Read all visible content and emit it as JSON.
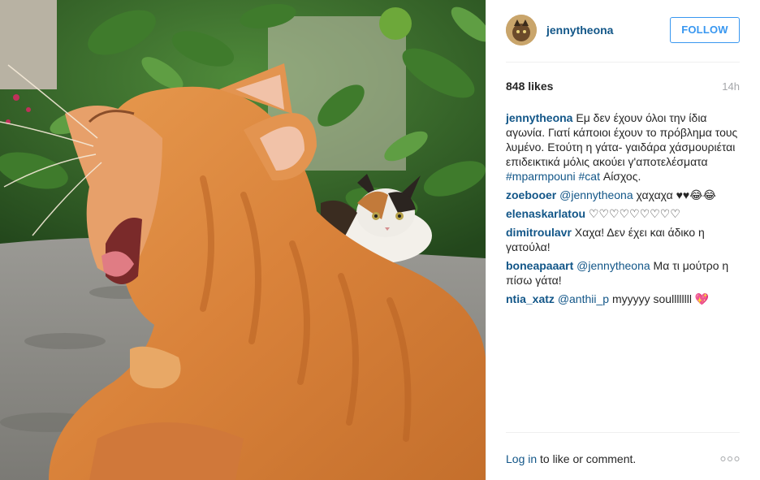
{
  "post": {
    "username": "jennytheona",
    "follow_label": "FOLLOW",
    "likes": "848 likes",
    "time": "14h"
  },
  "comments": [
    {
      "author": "jennytheona",
      "parts": [
        {
          "t": "text",
          "v": " Εμ δεν έχουν όλοι την ίδια αγωνία. Γιατί κάποιοι έχουν το πρόβλημα τους λυμένο. Ετούτη η γάτα- γαιδάρα χάσμουριέται επιδεικτικά μόλις ακούει γ'αποτελέσματα "
        },
        {
          "t": "tag",
          "v": "#mparmpouni"
        },
        {
          "t": "text",
          "v": " "
        },
        {
          "t": "tag",
          "v": "#cat"
        },
        {
          "t": "text",
          "v": " Αίσχος."
        }
      ]
    },
    {
      "author": "zoebooer",
      "parts": [
        {
          "t": "text",
          "v": " "
        },
        {
          "t": "mention",
          "v": "@jennytheona"
        },
        {
          "t": "text",
          "v": " χαχαχα ♥♥😂😂"
        }
      ]
    },
    {
      "author": "elenaskarlatou",
      "parts": [
        {
          "t": "text",
          "v": " ♡♡♡♡♡♡♡♡♡"
        }
      ]
    },
    {
      "author": "dimitroulavr",
      "parts": [
        {
          "t": "text",
          "v": " Χαχα! Δεν έχει και άδικο η γατούλα!"
        }
      ]
    },
    {
      "author": "boneapaaart",
      "parts": [
        {
          "t": "text",
          "v": " "
        },
        {
          "t": "mention",
          "v": "@jennytheona"
        },
        {
          "t": "text",
          "v": " Μα τι μούτρο η πίσω γάτα!"
        }
      ]
    },
    {
      "author": "ntia_xatz",
      "parts": [
        {
          "t": "text",
          "v": " "
        },
        {
          "t": "mention",
          "v": "@anthii_p"
        },
        {
          "t": "text",
          "v": " myyyyy soullllllll "
        },
        {
          "t": "heart",
          "v": "💖"
        }
      ]
    }
  ],
  "footer": {
    "login_link": "Log in",
    "login_rest": "to like or comment.",
    "more_icon": "more-options-icon"
  },
  "colors": {
    "link": "#125688",
    "follow": "#3897f0",
    "muted": "#a5a7aa",
    "text": "#262626"
  }
}
